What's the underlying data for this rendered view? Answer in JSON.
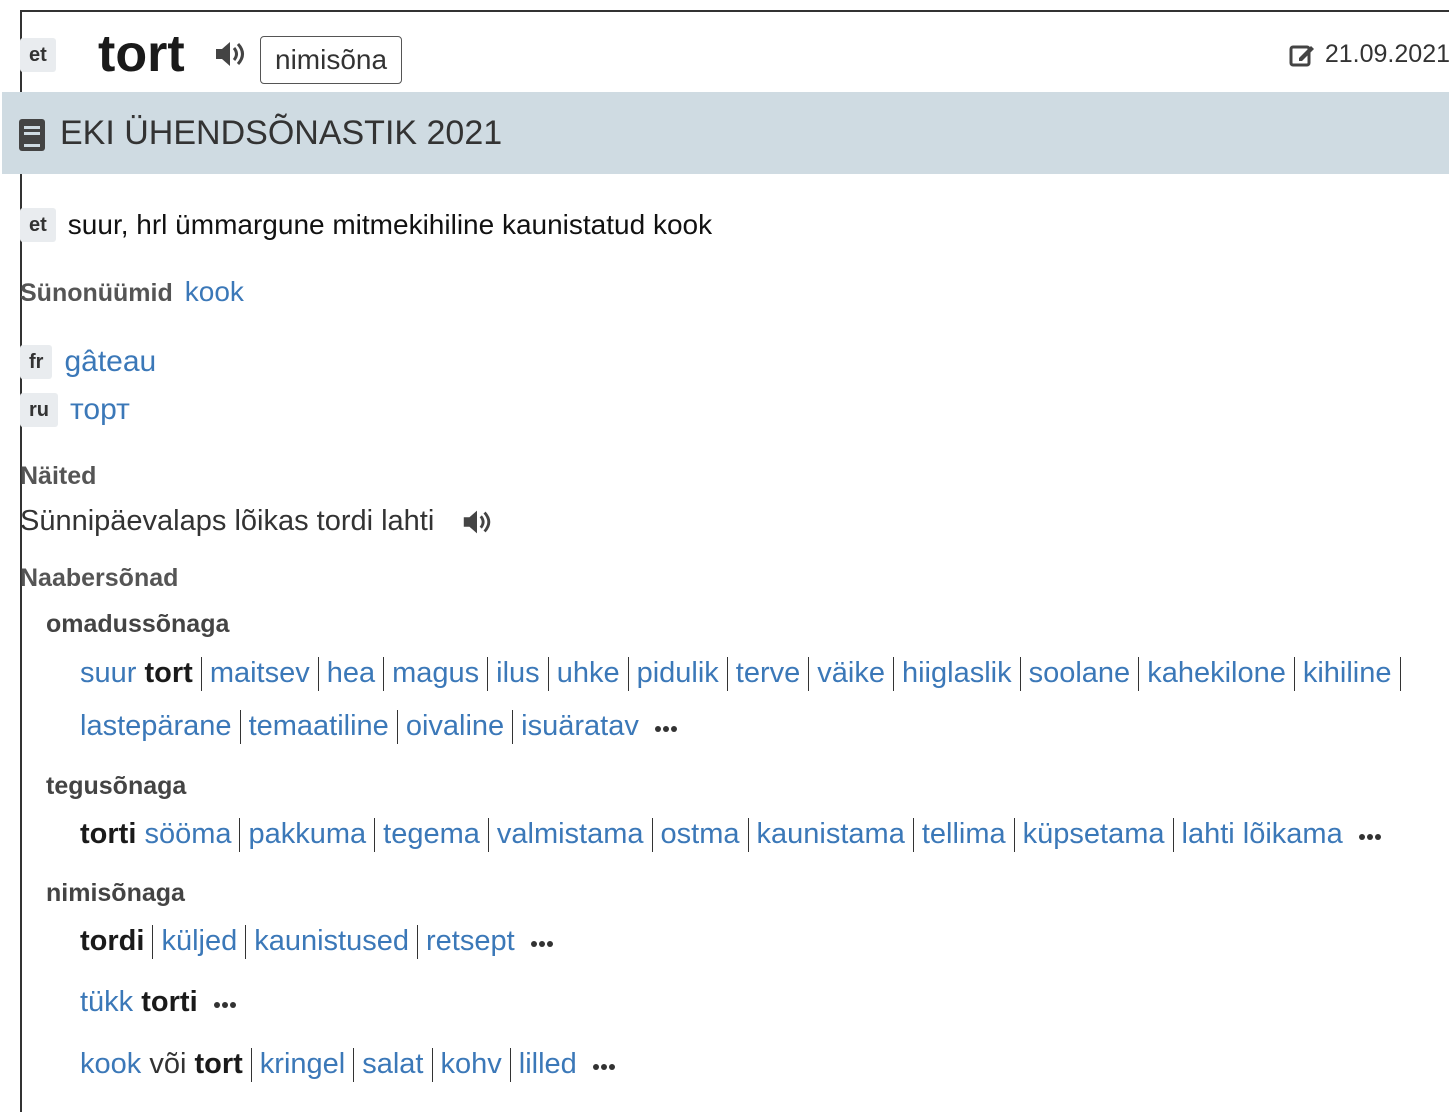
{
  "header": {
    "lang": "et",
    "headword": "tort",
    "pos": "nimisõna",
    "date": "21.09.2021"
  },
  "dictionary": {
    "title": "EKI ÜHENDSÕNASTIK 2021"
  },
  "definition": {
    "lang": "et",
    "text": "suur, hrl ümmargune mitmekihiline kaunistatud kook"
  },
  "synonyms": {
    "label": "Sünonüümid",
    "items": [
      "kook"
    ]
  },
  "translations": [
    {
      "lang": "fr",
      "word": "gâteau"
    },
    {
      "lang": "ru",
      "word": "торт"
    }
  ],
  "examples": {
    "label": "Näited",
    "items": [
      "Sünnipäevalaps lõikas tordi lahti"
    ]
  },
  "collocations": {
    "label": "Naabersõnad",
    "groups": [
      {
        "label": "omadussõnaga",
        "lines": [
          {
            "parts": [
              "suur",
              "tort",
              "maitsev",
              "hea",
              "magus",
              "ilus",
              "uhke",
              "pidulik",
              "terve",
              "väike",
              "hiiglaslik",
              "soolane",
              "kahekilone",
              "kihiline"
            ]
          },
          {
            "parts": [
              "lastepärane",
              "temaatiline",
              "oivaline",
              "isuäratav"
            ]
          }
        ]
      },
      {
        "label": "tegusõnaga",
        "lines": [
          {
            "parts": [
              "torti",
              "sööma",
              "pakkuma",
              "tegema",
              "valmistama",
              "ostma",
              "kaunistama",
              "tellima",
              "küpsetama",
              "lahti lõikama"
            ]
          }
        ]
      },
      {
        "label": "nimisõnaga",
        "lines": [
          {
            "parts": [
              "tordi",
              "küljed",
              "kaunistused",
              "retsept"
            ]
          },
          {
            "parts": [
              "tükk",
              "torti"
            ]
          },
          {
            "parts": [
              "kook",
              "või",
              "tort",
              "kringel",
              "salat",
              "kohv",
              "lilled"
            ]
          }
        ]
      }
    ]
  },
  "colors": {
    "link": "#3b78b8",
    "banner": "#cfdbe2",
    "tag_bg": "#e9ecef"
  }
}
